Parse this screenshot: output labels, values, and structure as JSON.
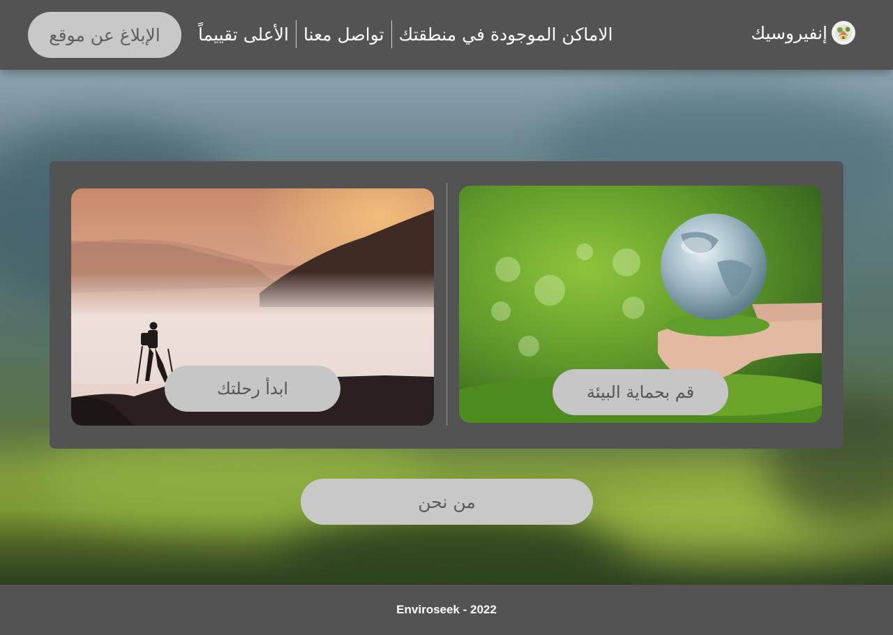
{
  "header": {
    "brand_name": "إنفيروسيك",
    "report_button": "الإبلاغ عن موقع",
    "nav": [
      {
        "label": "الأعلى تقييماً"
      },
      {
        "label": "تواصل معنا"
      },
      {
        "label": "الاماكن الموجودة في منطقتك"
      }
    ]
  },
  "cards": {
    "protect_environment": {
      "button": "قم بحماية البيئة",
      "image": "globe-in-hands-photo"
    },
    "start_journey": {
      "button": "ابدأ رحلتك",
      "image": "hiker-on-mountain-photo"
    }
  },
  "about_button": "من نحن",
  "footer": {
    "text": "Enviroseek - 2022"
  },
  "colors": {
    "bar": "#535353",
    "button": "#c8c8c8",
    "button_text": "#5a5a5a",
    "white_text": "#ffffff"
  }
}
